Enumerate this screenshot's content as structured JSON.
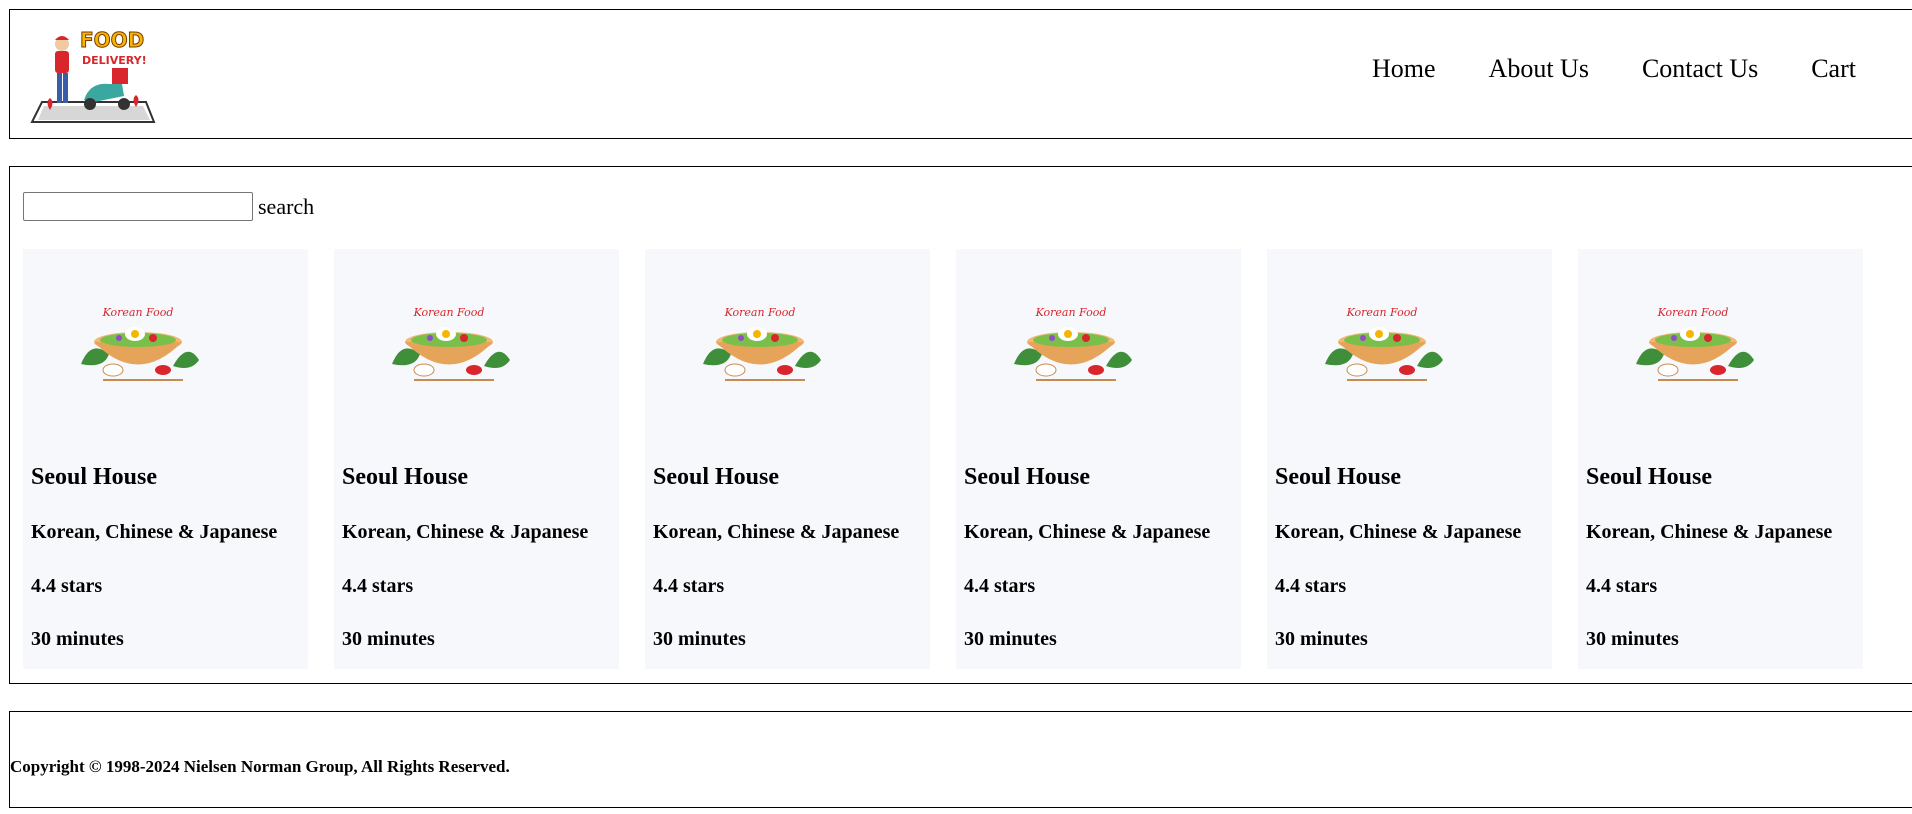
{
  "header": {
    "logo_text_top": "FOOD",
    "logo_text_bottom": "DELIVERY!",
    "nav": [
      "Home",
      "About Us",
      "Contact Us",
      "Cart"
    ]
  },
  "search": {
    "value": "",
    "label": "search"
  },
  "cards": [
    {
      "thumb_text": "Korean Food",
      "name": "Seoul House",
      "cuisine": "Korean, Chinese & Japanese",
      "rating": "4.4 stars",
      "time": "30 minutes"
    },
    {
      "thumb_text": "Korean Food",
      "name": "Seoul House",
      "cuisine": "Korean, Chinese & Japanese",
      "rating": "4.4 stars",
      "time": "30 minutes"
    },
    {
      "thumb_text": "Korean Food",
      "name": "Seoul House",
      "cuisine": "Korean, Chinese & Japanese",
      "rating": "4.4 stars",
      "time": "30 minutes"
    },
    {
      "thumb_text": "Korean Food",
      "name": "Seoul House",
      "cuisine": "Korean, Chinese & Japanese",
      "rating": "4.4 stars",
      "time": "30 minutes"
    },
    {
      "thumb_text": "Korean Food",
      "name": "Seoul House",
      "cuisine": "Korean, Chinese & Japanese",
      "rating": "4.4 stars",
      "time": "30 minutes"
    },
    {
      "thumb_text": "Korean Food",
      "name": "Seoul House",
      "cuisine": "Korean, Chinese & Japanese",
      "rating": "4.4 stars",
      "time": "30 minutes"
    }
  ],
  "footer": {
    "copyright": "Copyright © 1998-2024 Nielsen Norman Group, All Rights Reserved."
  },
  "colors": {
    "card_bg": "#f7f8fc",
    "border": "#000000",
    "logo_yellow": "#f7b500",
    "logo_red": "#d8262c",
    "bowl": "#e6a35a",
    "leaf": "#3f8f3a"
  },
  "icons": {
    "logo": "delivery-scooter-logo-icon",
    "thumb": "korean-food-bowl-icon"
  }
}
